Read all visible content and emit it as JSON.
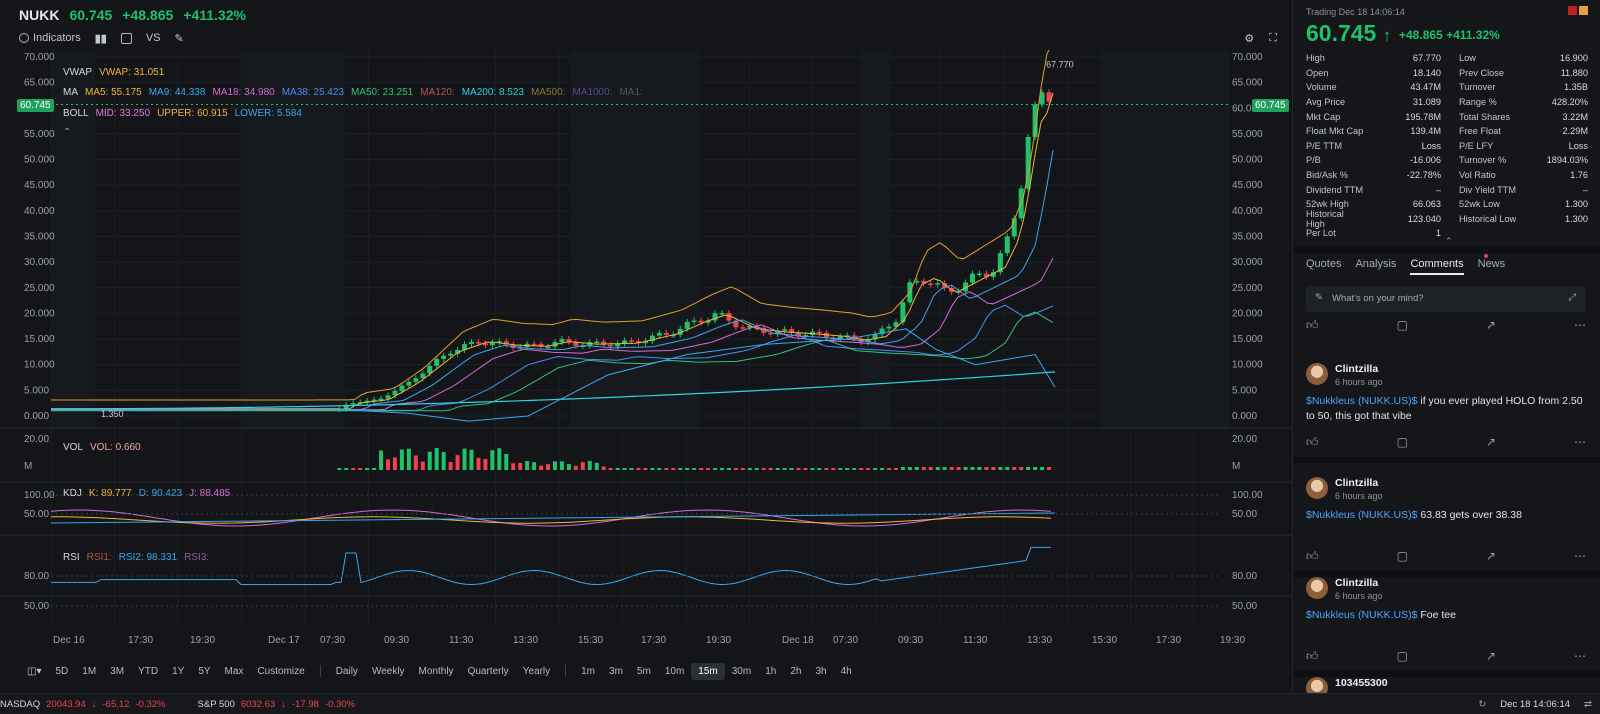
{
  "header": {
    "symbol": "NUKK",
    "price": "60.745",
    "change": "+48.865",
    "change_pct": "+411.32%"
  },
  "toolbar": {
    "indicators": "Indicators",
    "vs": "VS"
  },
  "overlays": {
    "vwap": {
      "label": "VWAP",
      "value": "VWAP: 31.051"
    },
    "ma": {
      "label": "MA",
      "items": [
        "MA5: 55.175",
        "MA9: 44.338",
        "MA18: 34.980",
        "MA38: 25.423",
        "MA50: 23.251",
        "MA120:",
        "MA200: 8.523",
        "MA500:",
        "MA1000:",
        "MA1:"
      ]
    },
    "boll": {
      "label": "BOLL",
      "mid": "MID: 33.250",
      "upper": "UPPER: 60.915",
      "lower": "LOWER: 5.584"
    }
  },
  "price_axis": [
    "70.000",
    "65.000",
    "60.000",
    "55.000",
    "50.000",
    "45.000",
    "40.000",
    "35.000",
    "30.000",
    "25.000",
    "20.000",
    "15.000",
    "10.000",
    "5.000",
    "0.000"
  ],
  "price_tag": "60.745",
  "chart_labels": {
    "high": "67.770",
    "low": "1.350"
  },
  "vol": {
    "label": "VOL",
    "value": "VOL: 0.660",
    "axis": [
      "20.00",
      "M"
    ]
  },
  "kdj": {
    "label": "KDJ",
    "k": "K: 89.777",
    "d": "D: 90.423",
    "j": "J: 88.485",
    "axis": [
      "100.00",
      "50.00"
    ]
  },
  "rsi": {
    "label": "RSI",
    "rsi1": "RSI1:",
    "rsi2": "RSI2: 98.331",
    "rsi3": "RSI3:",
    "axis": [
      "80.00",
      "50.00"
    ]
  },
  "time_axis": [
    "Dec 16",
    "17:30",
    "19:30",
    "Dec 17",
    "07:30",
    "09:30",
    "11:30",
    "13:30",
    "15:30",
    "17:30",
    "19:30",
    "Dec 18",
    "07:30",
    "09:30",
    "11:30",
    "13:30",
    "15:30",
    "17:30",
    "19:30"
  ],
  "timeframes": [
    "5D",
    "1M",
    "3M",
    "YTD",
    "1Y",
    "5Y",
    "Max",
    "Customize",
    "Daily",
    "Weekly",
    "Monthly",
    "Quarterly",
    "Yearly",
    "1m",
    "3m",
    "5m",
    "10m",
    "15m",
    "30m",
    "1h",
    "2h",
    "3h",
    "4h"
  ],
  "selected_timeframe": "15m",
  "chart_data": {
    "type": "candlestick",
    "price_points": [
      [
        0,
        1.35
      ],
      [
        100,
        1.35
      ],
      [
        290,
        1.36
      ],
      [
        300,
        2.5
      ],
      [
        330,
        3.2
      ],
      [
        360,
        6.5
      ],
      [
        380,
        9.5
      ],
      [
        400,
        12.5
      ],
      [
        430,
        14.5
      ],
      [
        460,
        13.8
      ],
      [
        490,
        13.6
      ],
      [
        510,
        14.5
      ],
      [
        540,
        14.0
      ],
      [
        580,
        14.2
      ],
      [
        620,
        16.0
      ],
      [
        650,
        18.5
      ],
      [
        670,
        19.8
      ],
      [
        700,
        17.0
      ],
      [
        730,
        16.4
      ],
      [
        760,
        16.0
      ],
      [
        790,
        15.5
      ],
      [
        810,
        14.8
      ],
      [
        830,
        15.5
      ],
      [
        850,
        19.0
      ],
      [
        865,
        25.5
      ],
      [
        880,
        27.0
      ],
      [
        900,
        24.0
      ],
      [
        915,
        25.5
      ],
      [
        930,
        27.0
      ],
      [
        950,
        29.0
      ],
      [
        965,
        35.0
      ],
      [
        975,
        45.0
      ],
      [
        985,
        57.0
      ],
      [
        995,
        60.0
      ],
      [
        1000,
        65.0
      ],
      [
        1010,
        60.745
      ]
    ],
    "high": 67.77,
    "low": 1.35,
    "last": 60.745
  },
  "panel": {
    "trading": "Trading Dec 18 14:06:14",
    "price": "60.745",
    "arrow": "↑",
    "change": "+48.865",
    "change_pct": "+411.32%",
    "stats": [
      [
        "High",
        "67.770",
        "green",
        "Low",
        "16.900",
        "green"
      ],
      [
        "Open",
        "18.140",
        "green",
        "Prev Close",
        "11.880",
        ""
      ],
      [
        "Volume",
        "43.47M",
        "",
        "Turnover",
        "1.35B",
        ""
      ],
      [
        "Avg Price",
        "31.089",
        "green",
        "Range %",
        "428.20%",
        ""
      ],
      [
        "Mkt Cap",
        "195.78M",
        "",
        "Total Shares",
        "3.22M",
        ""
      ],
      [
        "Float Mkt Cap",
        "139.4M",
        "",
        "Free Float",
        "2.29M",
        ""
      ],
      [
        "P/E TTM",
        "Loss",
        "",
        "P/E LFY",
        "Loss",
        ""
      ],
      [
        "P/B",
        "-16.006",
        "",
        "Turnover %",
        "1894.03%",
        ""
      ],
      [
        "Bid/Ask %",
        "-22.78%",
        "",
        "Vol Ratio",
        "1.76",
        ""
      ],
      [
        "Dividend TTM",
        "–",
        "",
        "Div Yield TTM",
        "–",
        ""
      ],
      [
        "52wk High",
        "66.063",
        "green",
        "52wk Low",
        "1.300",
        "red"
      ],
      [
        "Historical High",
        "123.040",
        "green",
        "Historical Low",
        "1.300",
        "red"
      ],
      [
        "Per Lot",
        "1",
        "",
        "",
        "",
        ""
      ]
    ],
    "tabs": [
      "Quotes",
      "Analysis",
      "Comments",
      "News"
    ],
    "active_tab": "Comments",
    "composer": "What's on your mind?",
    "posts": [
      {
        "name": "Clintzilla",
        "time": "6 hours ago",
        "tag": "$Nukkleus (NUKK.US)$",
        "text": " if you ever played HOLO from 2.50 to 50, this got that vibe"
      },
      {
        "name": "Clintzilla",
        "time": "6 hours ago",
        "tag": "$Nukkleus (NUKK.US)$",
        "text": " 63.83 gets over 38.38"
      },
      {
        "name": "Clintzilla",
        "time": "6 hours ago",
        "tag": "$Nukkleus (NUKK.US)$",
        "text": " Foe tee"
      },
      {
        "name": "103455300",
        "time": "",
        "tag": "",
        "text": ""
      }
    ]
  },
  "ticker": {
    "nasdaq": {
      "name": "NASDAQ",
      "value": "20043.94",
      "arrow": "↓",
      "change": "-65.12",
      "pct": "-0.32%"
    },
    "sp500": {
      "name": "S&P 500",
      "value": "6032.63",
      "arrow": "↓",
      "change": "-17.98",
      "pct": "-0.30%"
    },
    "time": "Dec 18 14:06:14"
  },
  "colors": {
    "up": "#1fc16b",
    "down": "#f0424d",
    "bg": "#131519"
  }
}
